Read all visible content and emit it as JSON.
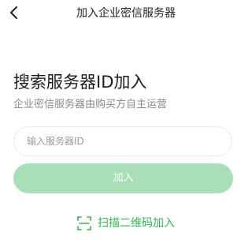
{
  "nav": {
    "title": "加入企业密信服务器"
  },
  "main": {
    "headline": "搜索服务器ID加入",
    "subline": "企业密信服务器由购买方自主运营",
    "input_placeholder": "输入服务器ID",
    "join_label": "加入",
    "scan_label": "扫描二维码加入"
  },
  "icons": {
    "back": "chevron-left-icon",
    "scan": "qr-scan-icon"
  },
  "colors": {
    "accent": "#2fb84f",
    "button_disabled": "#a9dfb6",
    "subtext": "#8a8a8a"
  }
}
